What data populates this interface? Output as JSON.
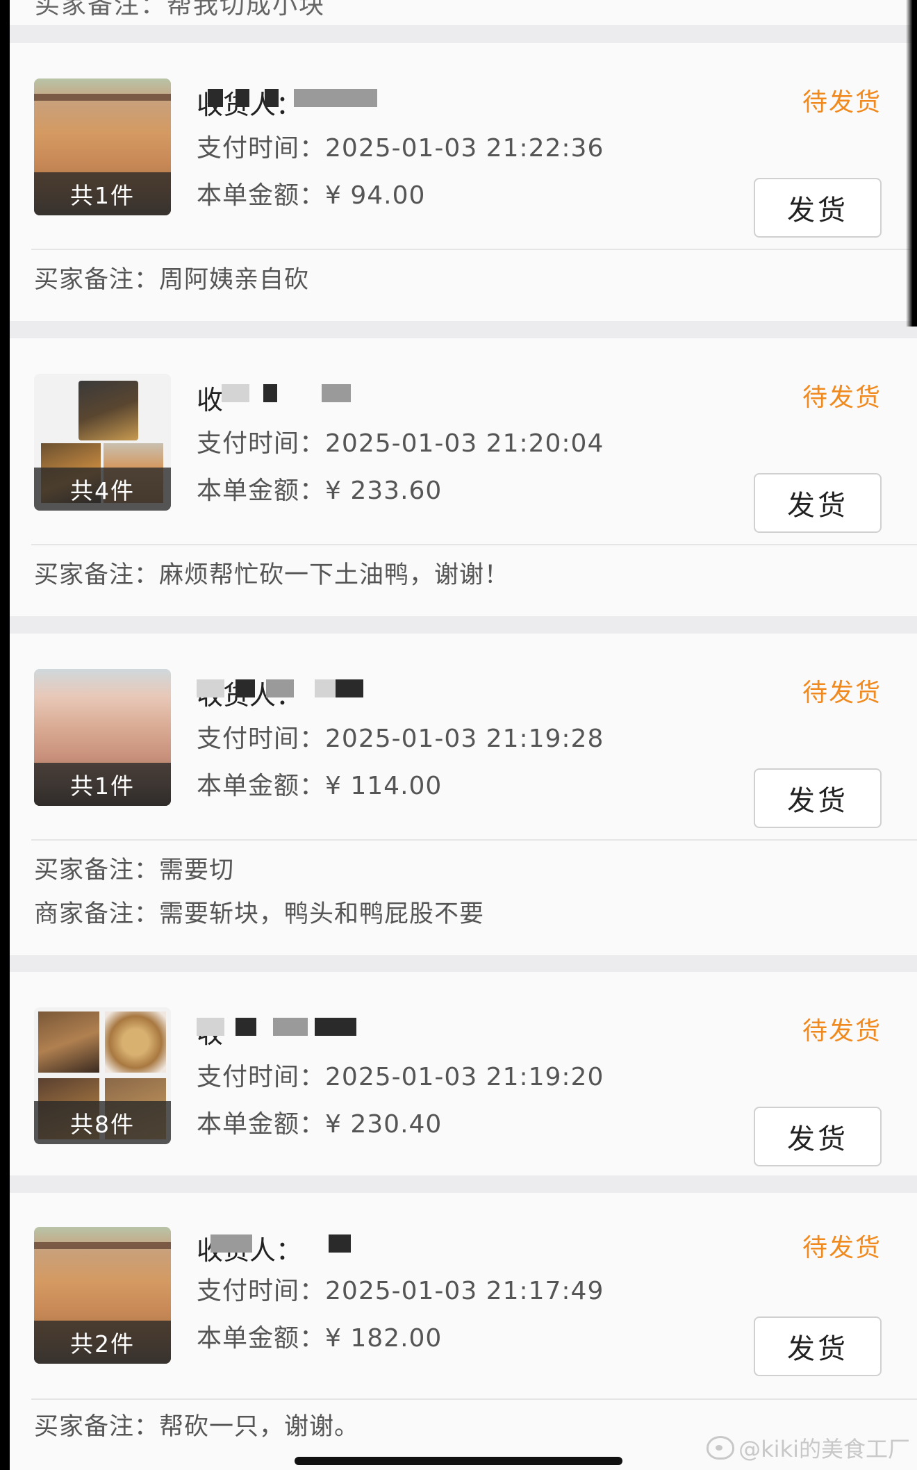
{
  "top_remnant": "买家备注：帮我切成小块",
  "status_label": "待发货",
  "ship_label": "发货",
  "pay_time_label": "支付时间：",
  "amount_label": "本单金额：",
  "currency": "¥",
  "buyer_note_label": "买家备注：",
  "seller_note_label": "商家备注：",
  "accent_color": "#f08a1f",
  "orders": [
    {
      "recipient": "收货人：",
      "count": "共1件",
      "pay_time": "2025-01-03 21:22:36",
      "amount": "94.00",
      "buyer_note": "周阿姨亲自砍"
    },
    {
      "recipient": "收",
      "count": "共4件",
      "pay_time": "2025-01-03 21:20:04",
      "amount": "233.60",
      "buyer_note": "麻烦帮忙砍一下土油鸭，谢谢！"
    },
    {
      "recipient": "收货人：",
      "count": "共1件",
      "pay_time": "2025-01-03 21:19:28",
      "amount": "114.00",
      "buyer_note": "需要切",
      "seller_note": "需要斩块，鸭头和鸭屁股不要"
    },
    {
      "recipient": "收",
      "count": "共8件",
      "pay_time": "2025-01-03 21:19:20",
      "amount": "230.40"
    },
    {
      "recipient": "收货人：",
      "count": "共2件",
      "pay_time": "2025-01-03 21:17:49",
      "amount": "182.00",
      "buyer_note": "帮砍一只，谢谢。"
    }
  ],
  "watermark": "@kiki的美食工厂"
}
